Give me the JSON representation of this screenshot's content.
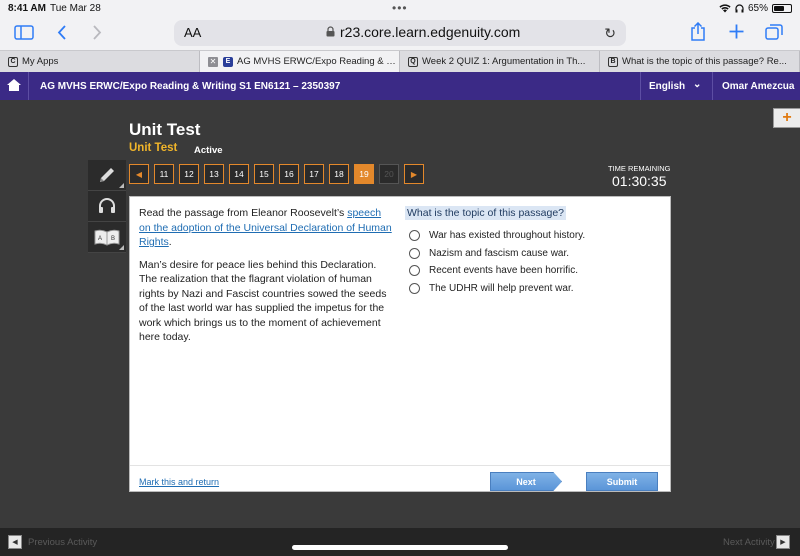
{
  "status_bar": {
    "time": "8:41 AM",
    "date": "Tue Mar 28",
    "battery": "65%",
    "battery_level": 0.65
  },
  "browser": {
    "text_size": "AA",
    "url": "r23.core.learn.edgenuity.com",
    "tabs": [
      {
        "title": "My Apps",
        "favicon": "C",
        "active": false
      },
      {
        "title": "AG MVHS ERWC/Expo Reading & Writ...",
        "favicon": "E",
        "active": true
      },
      {
        "title": "Week 2 QUIZ 1: Argumentation in Th...",
        "favicon": "Q",
        "active": false
      },
      {
        "title": "What is the topic of this passage? Re...",
        "favicon": "B",
        "active": false
      }
    ]
  },
  "course": {
    "title": "AG MVHS ERWC/Expo Reading & Writing S1 EN6121 – 2350397",
    "language": "English",
    "user": "Omar Amezcua"
  },
  "test": {
    "title": "Unit Test",
    "subtitle": "Unit Test",
    "status": "Active"
  },
  "nav": {
    "questions": [
      {
        "num": "11",
        "state": "normal"
      },
      {
        "num": "12",
        "state": "normal"
      },
      {
        "num": "13",
        "state": "normal"
      },
      {
        "num": "14",
        "state": "normal"
      },
      {
        "num": "15",
        "state": "normal"
      },
      {
        "num": "16",
        "state": "normal"
      },
      {
        "num": "17",
        "state": "normal"
      },
      {
        "num": "18",
        "state": "normal"
      },
      {
        "num": "19",
        "state": "current"
      },
      {
        "num": "20",
        "state": "disabled"
      }
    ]
  },
  "timer": {
    "label": "TIME REMAINING",
    "value": "01:30:35"
  },
  "passage": {
    "intro": "Read the passage from Eleanor Roosevelt’s ",
    "link": "speech on the adoption of the Universal Declaration of Human Rights",
    "intro_end": ".",
    "body": "Man’s desire for peace lies behind this Declaration. The realization that the flagrant violation of human rights by Nazi and Fascist countries sowed the seeds of the last world war has supplied the impetus for the work which brings us to the moment of achievement here today."
  },
  "question": {
    "text": "What is the topic of this passage?",
    "options": [
      "War has existed throughout history.",
      "Nazism and fascism cause war.",
      "Recent events have been horrific.",
      "The UDHR will help prevent war."
    ]
  },
  "footer": {
    "mark_label": "Mark this and return",
    "next_label": "Next",
    "submit_label": "Submit"
  },
  "bottom": {
    "prev_label": "Previous Activity",
    "next_label": "Next Activity"
  },
  "colors": {
    "accent": "#e3882b",
    "course_bar": "#3b2a86",
    "button_blue": "#5b95d8"
  }
}
